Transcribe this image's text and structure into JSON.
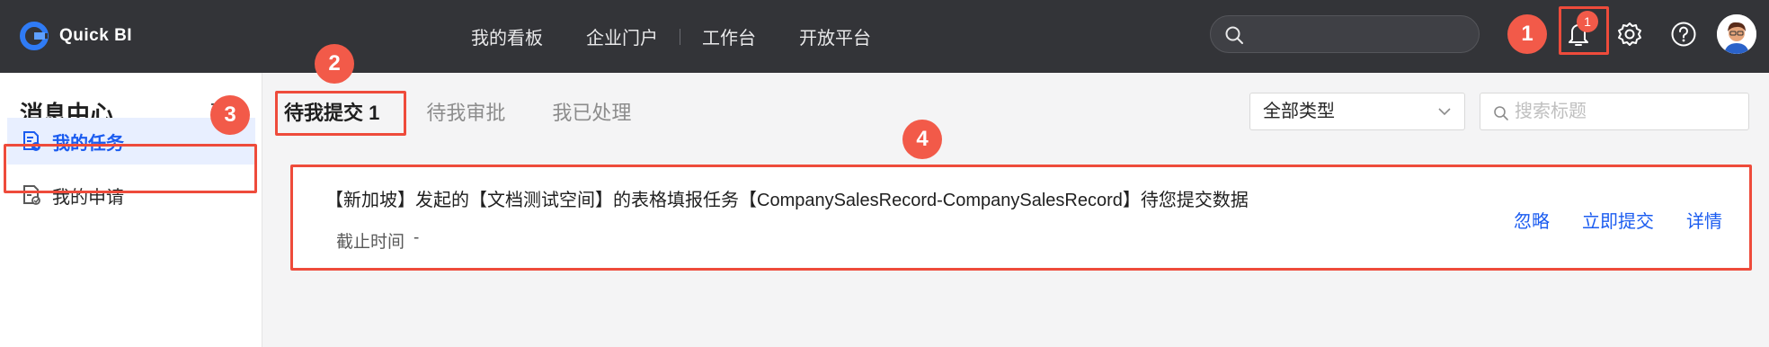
{
  "app": {
    "name": "Quick BI"
  },
  "nav": {
    "items": [
      "我的看板",
      "企业门户",
      "工作台",
      "开放平台"
    ]
  },
  "notifications": {
    "badge": "1"
  },
  "sidebar": {
    "title": "消息中心",
    "items": [
      {
        "label": "我的任务",
        "icon": "task-icon",
        "active": true
      },
      {
        "label": "我的申请",
        "icon": "application-icon",
        "active": false
      }
    ]
  },
  "tabs": [
    {
      "label": "待我提交 1",
      "active": true
    },
    {
      "label": "待我审批",
      "active": false
    },
    {
      "label": "我已处理",
      "active": false
    }
  ],
  "filters": {
    "type_select": "全部类型",
    "search_placeholder": "搜索标题"
  },
  "task": {
    "title": "【新加坡】发起的【文档测试空间】的表格填报任务【CompanySalesRecord-CompanySalesRecord】待您提交数据",
    "deadline_label": "截止时间",
    "deadline_value": "-",
    "actions": {
      "ignore": "忽略",
      "submit": "立即提交",
      "details": "详情"
    }
  },
  "callouts": [
    "1",
    "2",
    "3",
    "4"
  ],
  "colors": {
    "accent": "#1b5cf0",
    "annotation": "#ee4b3b",
    "topbar": "#333438"
  }
}
